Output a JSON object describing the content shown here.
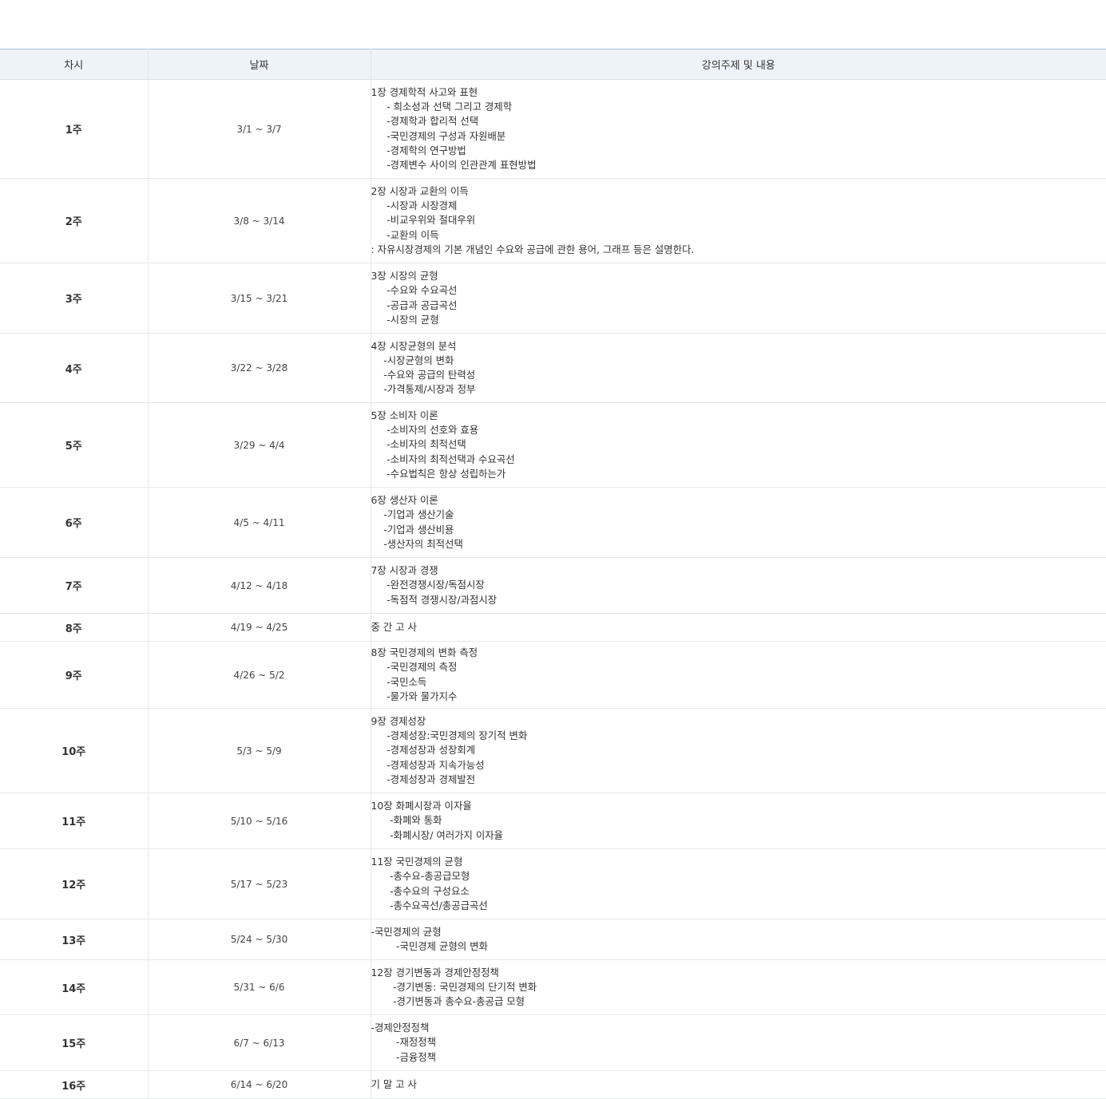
{
  "table": {
    "headers": [
      "차시",
      "날짜",
      "강의주제 및 내용"
    ],
    "rows": [
      {
        "week": "1주",
        "date": "3/1 ~ 3/7",
        "content": "1장 경제학적 사고와 표현\n     - 희소성과 선택 그리고 경제학\n     -경제학과 합리적 선택\n     -국민경제의 구성과 자원배분\n     -경제학의 연구방법\n     -경제변수 사이의 인관관계 표현방법"
      },
      {
        "week": "2주",
        "date": "3/8 ~ 3/14",
        "content": "2장 시장과 교환의 이득\n     -시장과 시장경제\n     -비교우위와 절대우위\n     -교환의 이득\n: 자유시장경제의 기본 개념인 수요와 공급에 관한 용어, 그래프 등은 설명한다."
      },
      {
        "week": "3주",
        "date": "3/15 ~ 3/21",
        "content": "3장 시장의 균형\n     -수요와 수요곡선\n     -공급과 공급곡선\n     -시장의 균형"
      },
      {
        "week": "4주",
        "date": "3/22 ~ 3/28",
        "content": "4장 시장균형의 분석\n    -시장균형의 변화\n    -수요와 공급의 탄력성\n    -가격통제/시장과 정부"
      },
      {
        "week": "5주",
        "date": "3/29 ~ 4/4",
        "content": "5장 소비자 이론\n     -소비자의 선호와 효용\n     -소비자의 최적선택\n     -소비자의 최적선택과 수요곡선\n     -수요법칙은 항상 성립하는가"
      },
      {
        "week": "6주",
        "date": "4/5 ~ 4/11",
        "content": "6장 생산자 이론\n    -기업과 생산기술\n    -기업과 생산비용\n    -생산자의 최적선택"
      },
      {
        "week": "7주",
        "date": "4/12 ~ 4/18",
        "content": "7장 시장과 경쟁\n     -완전경쟁시장/독점시장\n     -독점적 경쟁시장/과점시장"
      },
      {
        "week": "8주",
        "date": "4/19 ~ 4/25",
        "content": "중 간 고 사"
      },
      {
        "week": "9주",
        "date": "4/26 ~ 5/2",
        "content": "8장 국민경제의 변화 측정\n     -국민경제의 측정\n     -국민소득\n     -물가와 물가지수"
      },
      {
        "week": "10주",
        "date": "5/3 ~ 5/9",
        "content": "9장 경제성장\n     -경제성장:국민경제의 장기적 변화\n     -경제성장과 성장회계\n     -경제성장과 지속가능성\n     -경제성장과 경제발전"
      },
      {
        "week": "11주",
        "date": "5/10 ~ 5/16",
        "content": "10장 화폐시장과 이자율\n      -화폐와 통화\n      -화폐시장/ 여러가지 이자율"
      },
      {
        "week": "12주",
        "date": "5/17 ~ 5/23",
        "content": "11장 국민경제의 균형\n      -총수요-총공급모형\n      -총수요의 구성요소\n      -총수요곡선/총공급곡선"
      },
      {
        "week": "13주",
        "date": "5/24 ~ 5/30",
        "content": "-국민경제의 균형\n        -국민경제 균형의 변화"
      },
      {
        "week": "14주",
        "date": "5/31 ~ 6/6",
        "content": "12장 경기변동과 경제안정정책\n       -경기변동: 국민경제의 단기적 변화\n       -경기변동과 총수요-총공급 모형"
      },
      {
        "week": "15주",
        "date": "6/7 ~ 6/13",
        "content": "-경제안정정책\n        -재정정책\n        -금융정책"
      },
      {
        "week": "16주",
        "date": "6/14 ~ 6/20",
        "content": "기 말 고 사"
      }
    ]
  }
}
